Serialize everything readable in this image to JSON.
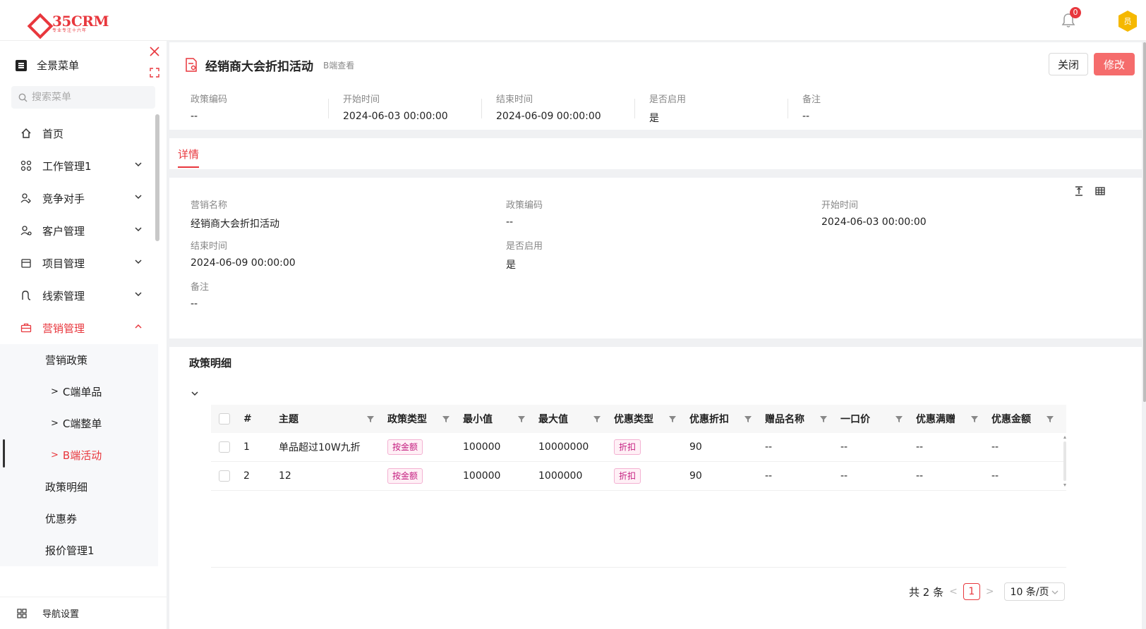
{
  "brand": {
    "name": "35CRM",
    "slogan": "专业专注十六年"
  },
  "topbar": {
    "notification_count": "0",
    "avatar_text": "员"
  },
  "sidebar": {
    "menu_all_label": "全景菜单",
    "search_placeholder": "搜索菜单",
    "items": [
      {
        "label": "首页"
      },
      {
        "label": "工作管理1"
      },
      {
        "label": "竞争对手"
      },
      {
        "label": "客户管理"
      },
      {
        "label": "项目管理"
      },
      {
        "label": "线索管理"
      },
      {
        "label": "营销管理"
      }
    ],
    "sub_items": [
      {
        "label": "营销政策"
      },
      {
        "label": "C端单品"
      },
      {
        "label": "C端整单"
      },
      {
        "label": "B端活动"
      },
      {
        "label": "政策明细"
      },
      {
        "label": "优惠券"
      },
      {
        "label": "报价管理1"
      }
    ],
    "nav_setting_label": "导航设置"
  },
  "header": {
    "title": "经销商大会折扣活动",
    "subtitle": "B端查看",
    "close_label": "关闭",
    "edit_label": "修改"
  },
  "summary": [
    {
      "label": "政策编码",
      "value": "--"
    },
    {
      "label": "开始时间",
      "value": "2024-06-03 00:00:00"
    },
    {
      "label": "结束时间",
      "value": "2024-06-09 00:00:00"
    },
    {
      "label": "是否启用",
      "value": "是"
    },
    {
      "label": "备注",
      "value": "--"
    }
  ],
  "tabs": {
    "detail": "详情"
  },
  "detail": {
    "marketing_name": {
      "label": "营销名称",
      "value": "经销商大会折扣活动"
    },
    "policy_code": {
      "label": "政策编码",
      "value": "--"
    },
    "start_time": {
      "label": "开始时间",
      "value": "2024-06-03 00:00:00"
    },
    "end_time": {
      "label": "结束时间",
      "value": "2024-06-09 00:00:00"
    },
    "enabled": {
      "label": "是否启用",
      "value": "是"
    },
    "remark": {
      "label": "备注",
      "value": "--"
    }
  },
  "policy": {
    "title": "政策明细",
    "columns": [
      "#",
      "主题",
      "政策类型",
      "最小值",
      "最大值",
      "优惠类型",
      "优惠折扣",
      "赠品名称",
      "一口价",
      "优惠满赠",
      "优惠金额"
    ],
    "rows": [
      {
        "num": "1",
        "subject": "单品超过10W九折",
        "policy_type": "按金额",
        "min": "100000",
        "max": "10000000",
        "discount_type": "折扣",
        "discount": "90",
        "gift": "--",
        "fixed_price": "--",
        "full_gift": "--",
        "amount": "--"
      },
      {
        "num": "2",
        "subject": "12",
        "policy_type": "按金额",
        "min": "100000",
        "max": "1000000",
        "discount_type": "折扣",
        "discount": "90",
        "gift": "--",
        "fixed_price": "--",
        "full_gift": "--",
        "amount": "--"
      }
    ],
    "pagination": {
      "total": "共 2 条",
      "current_page": "1",
      "page_size": "10 条/页"
    }
  },
  "colors": {
    "accent": "#e8373d",
    "edit_button": "#f56c6c",
    "tag_magenta": "#c41d7f"
  }
}
